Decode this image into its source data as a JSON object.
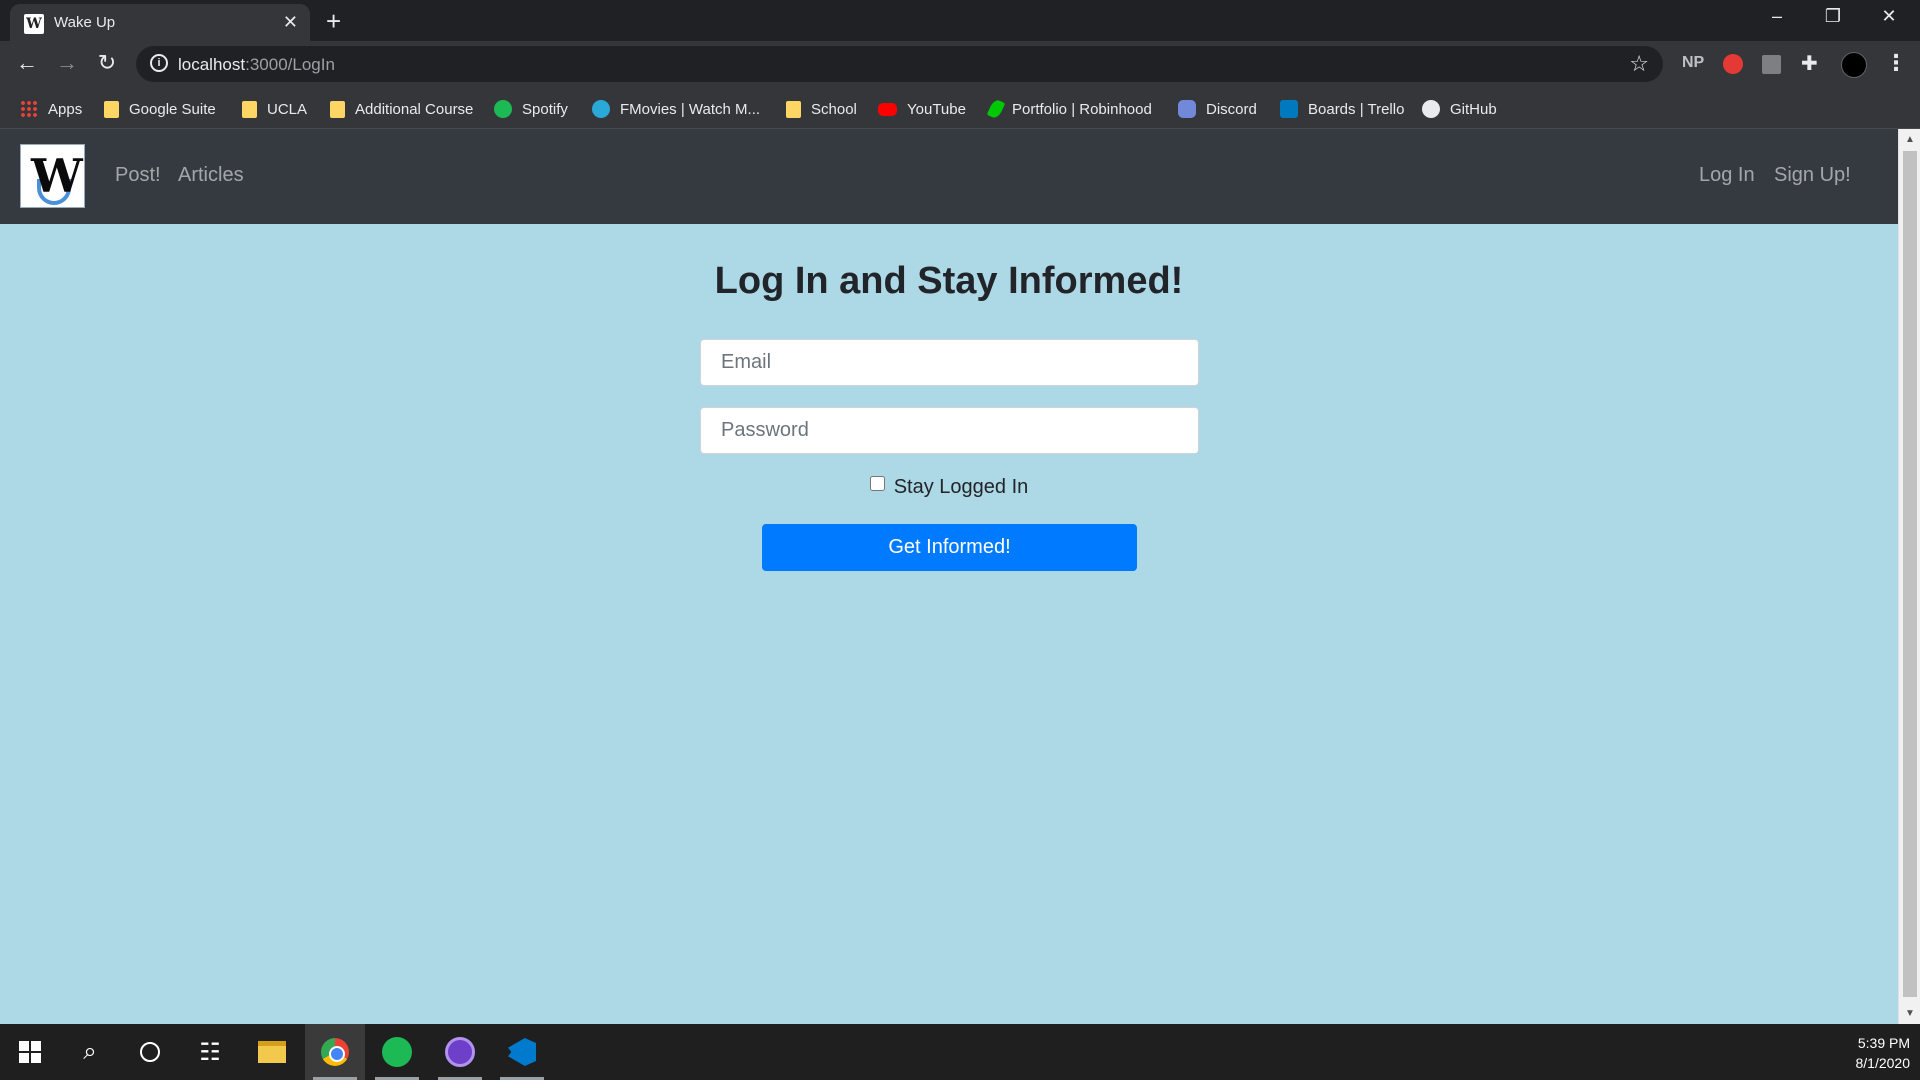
{
  "browser": {
    "tab": {
      "title": "Wake Up",
      "favicon": "W"
    },
    "address": {
      "host": "localhost",
      "path": ":3000/LogIn"
    },
    "extensions": {
      "np_label": "NP"
    },
    "bookmarks": [
      {
        "label": "Apps",
        "icon": "apps-icon"
      },
      {
        "label": "Google Suite",
        "icon": "folder-icon"
      },
      {
        "label": "UCLA",
        "icon": "folder-icon"
      },
      {
        "label": "Additional Course",
        "icon": "folder-icon"
      },
      {
        "label": "Spotify",
        "icon": "spotify-icon"
      },
      {
        "label": "FMovies | Watch M...",
        "icon": "fmovies-icon"
      },
      {
        "label": "School",
        "icon": "folder-icon"
      },
      {
        "label": "YouTube",
        "icon": "youtube-icon"
      },
      {
        "label": "Portfolio | Robinhood",
        "icon": "robinhood-icon"
      },
      {
        "label": "Discord",
        "icon": "discord-icon"
      },
      {
        "label": "Boards | Trello",
        "icon": "trello-icon"
      },
      {
        "label": "GitHub",
        "icon": "github-icon"
      }
    ]
  },
  "site": {
    "logo_letter": "W",
    "nav_left": [
      "Post!",
      "Articles"
    ],
    "nav_right": [
      "Log In",
      "Sign Up!"
    ]
  },
  "login": {
    "title": "Log In and Stay Informed!",
    "email_placeholder": "Email",
    "password_placeholder": "Password",
    "remember_label": "Stay Logged In",
    "remember_checked": false,
    "submit_label": "Get Informed!"
  },
  "taskbar": {
    "apps": [
      "start",
      "search",
      "cortana",
      "task-view",
      "file-explorer",
      "chrome",
      "spotify",
      "github-desktop",
      "vscode"
    ],
    "time": "5:39 PM",
    "date": "8/1/2020"
  },
  "colors": {
    "page_background": "#add8e6",
    "navbar": "#343a40",
    "primary_button": "#007bff"
  }
}
